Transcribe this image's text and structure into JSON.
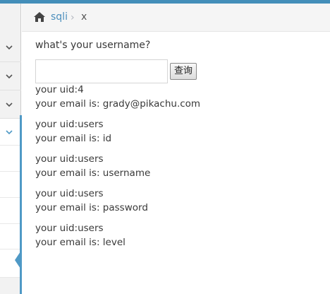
{
  "breadcrumb": {
    "home_icon": "home-icon",
    "link_label": "sqli",
    "separator": "›",
    "current": "x"
  },
  "sidebar": {
    "chevron_icon": "chevron-down-icon",
    "expanded_color": "#4f99c6"
  },
  "form": {
    "prompt": "what's your username?",
    "input_value": "",
    "button_label": "查询"
  },
  "results": [
    {
      "uid": "your uid:4",
      "email": "your email is: grady@pikachu.com"
    },
    {
      "uid": "your uid:users",
      "email": "your email is: id"
    },
    {
      "uid": "your uid:users",
      "email": "your email is: username"
    },
    {
      "uid": "your uid:users",
      "email": "your email is: password"
    },
    {
      "uid": "your uid:users",
      "email": "your email is: level"
    }
  ],
  "colors": {
    "accent": "#438eb9",
    "link": "#4c8fbd",
    "text": "#393939"
  }
}
